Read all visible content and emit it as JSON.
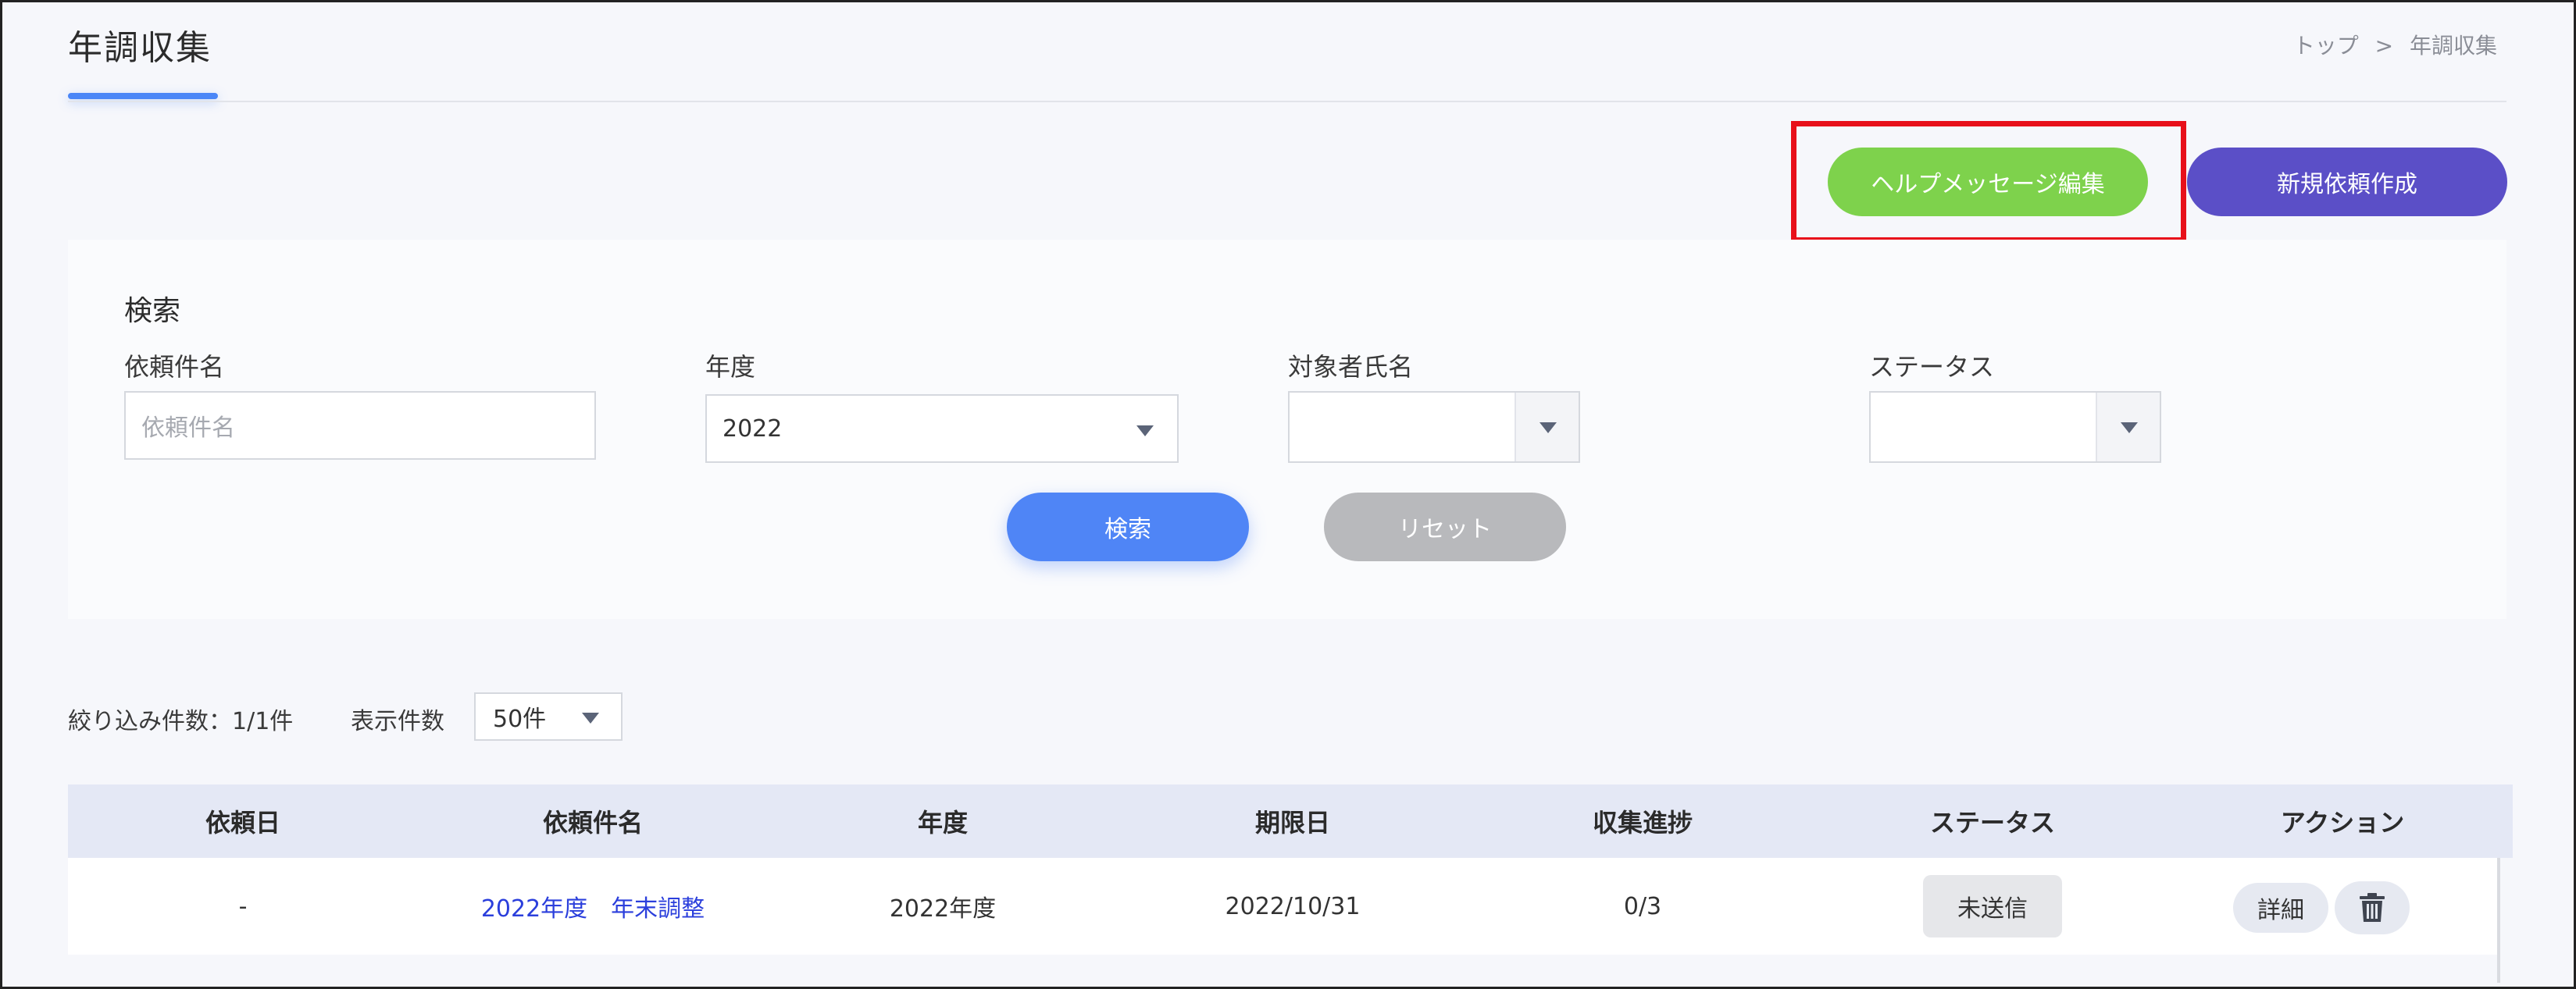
{
  "header": {
    "title": "年調収集",
    "breadcrumb": {
      "home": "トップ",
      "separator": ">",
      "current": "年調収集"
    }
  },
  "actions": {
    "help_message_label": "ヘルプメッセージ編集",
    "new_request_label": "新規依頼作成"
  },
  "search": {
    "title": "検索",
    "fields": {
      "request_name": {
        "label": "依頼件名",
        "placeholder": "依頼件名"
      },
      "year": {
        "label": "年度",
        "value": "2022"
      },
      "target_name": {
        "label": "対象者氏名",
        "value": ""
      },
      "status": {
        "label": "ステータス",
        "value": ""
      }
    },
    "search_button": "検索",
    "reset_button": "リセット"
  },
  "list": {
    "count_text": "絞り込み件数：1/1件",
    "per_page_label": "表示件数",
    "per_page_value": "50件"
  },
  "table": {
    "columns": [
      "依頼日",
      "依頼件名",
      "年度",
      "期限日",
      "収集進捗",
      "ステータス",
      "アクション"
    ],
    "rows": [
      {
        "request_date": "-",
        "request_name": "2022年度　年末調整",
        "year": "2022年度",
        "due_date": "2022/10/31",
        "progress": "0/3",
        "status": "未送信",
        "detail_label": "詳細"
      }
    ]
  },
  "colors": {
    "accent_blue": "#4f85f6",
    "help_green": "#7ed24c",
    "new_purple": "#5b4fc7",
    "highlight_red": "#e8101a"
  }
}
